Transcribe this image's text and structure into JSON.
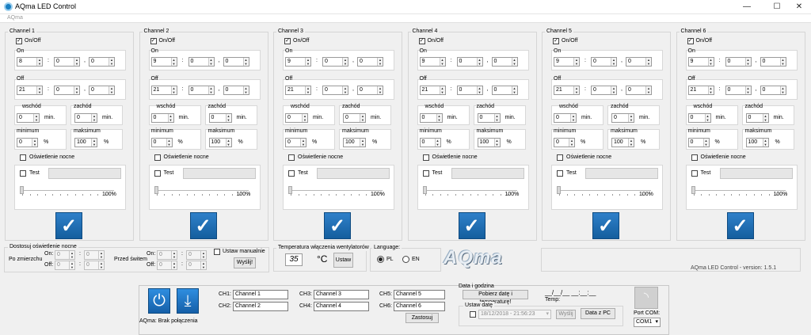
{
  "window": {
    "title": "AQma LED Control",
    "menu": "AQma",
    "minimize": "—",
    "maximize": "☐",
    "close": "✕"
  },
  "channels": [
    {
      "title": "Channel 1",
      "onoff_label": "On/Off",
      "on_label": "On",
      "on": [
        "8",
        "0",
        "0"
      ],
      "off_label": "Off",
      "off": [
        "21",
        "0",
        "0"
      ],
      "wschod_label": "wschód",
      "wschod": "0",
      "zachod_label": "zachód",
      "zachod": "0",
      "min_unit": "min.",
      "minimum_label": "minimum",
      "minimum": "0",
      "maksimum_label": "maksimum",
      "maksimum": "100",
      "pct": "%",
      "night_label": "Oświetlenie nocne",
      "test_label": "Test",
      "slider_max": "100%"
    },
    {
      "title": "Channel 2",
      "onoff_label": "On/Off",
      "on_label": "On",
      "on": [
        "9",
        "0",
        "0"
      ],
      "off_label": "Off",
      "off": [
        "21",
        "0",
        "0"
      ],
      "wschod_label": "wschód",
      "wschod": "0",
      "zachod_label": "zachód",
      "zachod": "0",
      "min_unit": "min.",
      "minimum_label": "minimum",
      "minimum": "0",
      "maksimum_label": "maksimum",
      "maksimum": "100",
      "pct": "%",
      "night_label": "Oświetlenie nocne",
      "test_label": "Test",
      "slider_max": "100%"
    },
    {
      "title": "Channel 3",
      "onoff_label": "On/Off",
      "on_label": "On",
      "on": [
        "9",
        "0",
        "0"
      ],
      "off_label": "Off",
      "off": [
        "21",
        "0",
        "0"
      ],
      "wschod_label": "wschód",
      "wschod": "0",
      "zachod_label": "zachód",
      "zachod": "0",
      "min_unit": "min.",
      "minimum_label": "minimum",
      "minimum": "0",
      "maksimum_label": "maksimum",
      "maksimum": "100",
      "pct": "%",
      "night_label": "Oświetlenie nocne",
      "test_label": "Test",
      "slider_max": "100%"
    },
    {
      "title": "Channel 4",
      "onoff_label": "On/Off",
      "on_label": "On",
      "on": [
        "9",
        "0",
        "0"
      ],
      "off_label": "Off",
      "off": [
        "21",
        "0",
        "0"
      ],
      "wschod_label": "wschód",
      "wschod": "0",
      "zachod_label": "zachód",
      "zachod": "0",
      "min_unit": "min.",
      "minimum_label": "minimum",
      "minimum": "0",
      "maksimum_label": "maksimum",
      "maksimum": "100",
      "pct": "%",
      "night_label": "Oświetlenie nocne",
      "test_label": "Test",
      "slider_max": "100%"
    },
    {
      "title": "Channel 5",
      "onoff_label": "On/Off",
      "on_label": "On",
      "on": [
        "9",
        "0",
        "0"
      ],
      "off_label": "Off",
      "off": [
        "21",
        "0",
        "0"
      ],
      "wschod_label": "wschód",
      "wschod": "0",
      "zachod_label": "zachód",
      "zachod": "0",
      "min_unit": "min.",
      "minimum_label": "minimum",
      "minimum": "0",
      "maksimum_label": "maksimum",
      "maksimum": "100",
      "pct": "%",
      "night_label": "Oświetlenie nocne",
      "test_label": "Test",
      "slider_max": "100%"
    },
    {
      "title": "Channel 6",
      "onoff_label": "On/Off",
      "on_label": "On",
      "on": [
        "9",
        "0",
        "0"
      ],
      "off_label": "Off",
      "off": [
        "21",
        "0",
        "0"
      ],
      "wschod_label": "wschód",
      "wschod": "0",
      "zachod_label": "zachód",
      "zachod": "0",
      "min_unit": "min.",
      "minimum_label": "minimum",
      "minimum": "0",
      "maksimum_label": "maksimum",
      "maksimum": "100",
      "pct": "%",
      "night_label": "Oświetlenie nocne",
      "test_label": "Test",
      "slider_max": "100%"
    }
  ],
  "night": {
    "title": "Dostosuj oświetlenie nocne",
    "po_zmierzchu": "Po zmierzchu",
    "przed_switem": "Przed świtem",
    "on_label": "On:",
    "off_label": "Off:",
    "v0": "0",
    "manual_label": "Ustaw manualnie",
    "send_label": "Wyślij!"
  },
  "fan": {
    "title": "Temperatura włączenia wentylatorów",
    "value": "35",
    "unit": "°C",
    "set_label": "Ustaw"
  },
  "language": {
    "title": "Language:",
    "pl": "PL",
    "en": "EN"
  },
  "brand": {
    "logo": "AQma",
    "version": "AQma LED Control - version: 1.5.1"
  },
  "status": {
    "connection": "AQma: Brak połączenia"
  },
  "names": {
    "labels": [
      "CH1:",
      "CH2:",
      "CH3:",
      "CH4:",
      "CH5:",
      "CH6:"
    ],
    "values": [
      "Channel 1",
      "Channel 2",
      "Channel 3",
      "Channel 4",
      "Channel 5",
      "Channel 6"
    ],
    "apply": "Zastosuj"
  },
  "datetime": {
    "title": "Data i godzina",
    "fetch": "Pobierz datę i temperaturę!",
    "clock": "__/__/__ __:__:__",
    "temp_label": "Temp:",
    "set_date_title": "Ustaw datę",
    "date_value": "18/12/2018 - 21:56:23",
    "send": "Wyślij",
    "from_pc": "Data z PC"
  },
  "port": {
    "label": "Port COM:",
    "value": "COM1"
  },
  "icons": {
    "power": "power-icon",
    "download": "download-icon",
    "rss": "rss-icon",
    "check": "check-icon"
  }
}
